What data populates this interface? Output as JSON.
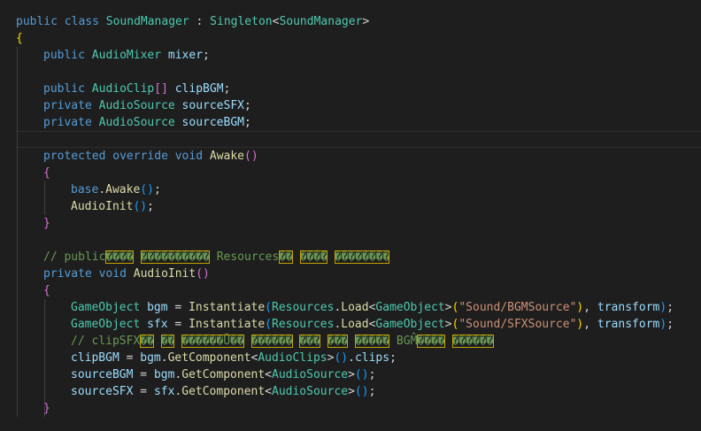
{
  "editor": {
    "lines": [
      {
        "indent": 0,
        "tokens": [
          {
            "t": "public",
            "c": "kw"
          },
          {
            "t": " ",
            "c": "pl"
          },
          {
            "t": "class",
            "c": "kw"
          },
          {
            "t": " ",
            "c": "pl"
          },
          {
            "t": "SoundManager",
            "c": "ty"
          },
          {
            "t": " : ",
            "c": "pl"
          },
          {
            "t": "Singleton",
            "c": "ty"
          },
          {
            "t": "<",
            "c": "pl"
          },
          {
            "t": "SoundManager",
            "c": "ty"
          },
          {
            "t": ">",
            "c": "pl"
          }
        ]
      },
      {
        "indent": 0,
        "tokens": [
          {
            "t": "{",
            "c": "br1"
          }
        ]
      },
      {
        "indent": 1,
        "tokens": [
          {
            "t": "public",
            "c": "kw"
          },
          {
            "t": " ",
            "c": "pl"
          },
          {
            "t": "AudioMixer",
            "c": "ty"
          },
          {
            "t": " ",
            "c": "pl"
          },
          {
            "t": "mixer",
            "c": "var"
          },
          {
            "t": ";",
            "c": "pl"
          }
        ]
      },
      {
        "indent": 0,
        "tokens": []
      },
      {
        "indent": 1,
        "tokens": [
          {
            "t": "public",
            "c": "kw"
          },
          {
            "t": " ",
            "c": "pl"
          },
          {
            "t": "AudioClip",
            "c": "ty"
          },
          {
            "t": "[]",
            "c": "br2"
          },
          {
            "t": " ",
            "c": "pl"
          },
          {
            "t": "clipBGM",
            "c": "var"
          },
          {
            "t": ";",
            "c": "pl"
          }
        ]
      },
      {
        "indent": 1,
        "tokens": [
          {
            "t": "private",
            "c": "kw"
          },
          {
            "t": " ",
            "c": "pl"
          },
          {
            "t": "AudioSource",
            "c": "ty"
          },
          {
            "t": " ",
            "c": "pl"
          },
          {
            "t": "sourceSFX",
            "c": "var"
          },
          {
            "t": ";",
            "c": "pl"
          }
        ]
      },
      {
        "indent": 1,
        "tokens": [
          {
            "t": "private",
            "c": "kw"
          },
          {
            "t": " ",
            "c": "pl"
          },
          {
            "t": "AudioSource",
            "c": "ty"
          },
          {
            "t": " ",
            "c": "pl"
          },
          {
            "t": "sourceBGM",
            "c": "var"
          },
          {
            "t": ";",
            "c": "pl"
          }
        ]
      },
      {
        "indent": 0,
        "tokens": [],
        "current": true
      },
      {
        "indent": 1,
        "tokens": [
          {
            "t": "protected",
            "c": "kw"
          },
          {
            "t": " ",
            "c": "pl"
          },
          {
            "t": "override",
            "c": "kw"
          },
          {
            "t": " ",
            "c": "pl"
          },
          {
            "t": "void",
            "c": "kw"
          },
          {
            "t": " ",
            "c": "pl"
          },
          {
            "t": "Awake",
            "c": "fn"
          },
          {
            "t": "()",
            "c": "br2"
          }
        ]
      },
      {
        "indent": 1,
        "tokens": [
          {
            "t": "{",
            "c": "br2"
          }
        ]
      },
      {
        "indent": 2,
        "tokens": [
          {
            "t": "base",
            "c": "kw"
          },
          {
            "t": ".",
            "c": "pl"
          },
          {
            "t": "Awake",
            "c": "fn"
          },
          {
            "t": "()",
            "c": "br3"
          },
          {
            "t": ";",
            "c": "pl"
          }
        ]
      },
      {
        "indent": 2,
        "tokens": [
          {
            "t": "AudioInit",
            "c": "fn"
          },
          {
            "t": "()",
            "c": "br3"
          },
          {
            "t": ";",
            "c": "pl"
          }
        ]
      },
      {
        "indent": 1,
        "tokens": [
          {
            "t": "}",
            "c": "br2"
          }
        ]
      },
      {
        "indent": 0,
        "tokens": []
      },
      {
        "indent": 1,
        "tokens": [
          {
            "t": "// public",
            "c": "cm"
          },
          {
            "t": "����",
            "c": "bad"
          },
          {
            "t": " ",
            "c": "cm"
          },
          {
            "t": "����������",
            "c": "bad"
          },
          {
            "t": " Resources",
            "c": "cm"
          },
          {
            "t": "��",
            "c": "bad"
          },
          {
            "t": " ",
            "c": "cm"
          },
          {
            "t": "���̂�",
            "c": "bad"
          },
          {
            "t": " ",
            "c": "cm"
          },
          {
            "t": "��������",
            "c": "bad"
          }
        ]
      },
      {
        "indent": 1,
        "tokens": [
          {
            "t": "private",
            "c": "kw"
          },
          {
            "t": " ",
            "c": "pl"
          },
          {
            "t": "void",
            "c": "kw"
          },
          {
            "t": " ",
            "c": "pl"
          },
          {
            "t": "AudioInit",
            "c": "fn"
          },
          {
            "t": "()",
            "c": "br2"
          }
        ]
      },
      {
        "indent": 1,
        "tokens": [
          {
            "t": "{",
            "c": "br2"
          }
        ]
      },
      {
        "indent": 2,
        "tokens": [
          {
            "t": "GameObject",
            "c": "ty"
          },
          {
            "t": " ",
            "c": "pl"
          },
          {
            "t": "bgm",
            "c": "var"
          },
          {
            "t": " = ",
            "c": "pl"
          },
          {
            "t": "Instantiate",
            "c": "fn"
          },
          {
            "t": "(",
            "c": "br3"
          },
          {
            "t": "Resources",
            "c": "ty"
          },
          {
            "t": ".",
            "c": "pl"
          },
          {
            "t": "Load",
            "c": "fn"
          },
          {
            "t": "<",
            "c": "pl"
          },
          {
            "t": "GameObject",
            "c": "ty"
          },
          {
            "t": ">",
            "c": "pl"
          },
          {
            "t": "(",
            "c": "br1"
          },
          {
            "t": "\"Sound/BGMSource\"",
            "c": "str"
          },
          {
            "t": ")",
            "c": "br1"
          },
          {
            "t": ", ",
            "c": "pl"
          },
          {
            "t": "transform",
            "c": "var"
          },
          {
            "t": ")",
            "c": "br3"
          },
          {
            "t": ";",
            "c": "pl"
          }
        ]
      },
      {
        "indent": 2,
        "tokens": [
          {
            "t": "GameObject",
            "c": "ty"
          },
          {
            "t": " ",
            "c": "pl"
          },
          {
            "t": "sfx",
            "c": "var"
          },
          {
            "t": " = ",
            "c": "pl"
          },
          {
            "t": "Instantiate",
            "c": "fn"
          },
          {
            "t": "(",
            "c": "br3"
          },
          {
            "t": "Resources",
            "c": "ty"
          },
          {
            "t": ".",
            "c": "pl"
          },
          {
            "t": "Load",
            "c": "fn"
          },
          {
            "t": "<",
            "c": "pl"
          },
          {
            "t": "GameObject",
            "c": "ty"
          },
          {
            "t": ">",
            "c": "pl"
          },
          {
            "t": "(",
            "c": "br1"
          },
          {
            "t": "\"Sound/SFXSource\"",
            "c": "str"
          },
          {
            "t": ")",
            "c": "br1"
          },
          {
            "t": ", ",
            "c": "pl"
          },
          {
            "t": "transform",
            "c": "var"
          },
          {
            "t": ")",
            "c": "br3"
          },
          {
            "t": ";",
            "c": "pl"
          }
        ]
      },
      {
        "indent": 2,
        "tokens": [
          {
            "t": "// clipSFX",
            "c": "cm"
          },
          {
            "t": "��",
            "c": "bad"
          },
          {
            "t": " ",
            "c": "cm"
          },
          {
            "t": "��",
            "c": "bad"
          },
          {
            "t": " ",
            "c": "cm"
          },
          {
            "t": "������Ŭ��",
            "c": "bad"
          },
          {
            "t": " ",
            "c": "cm"
          },
          {
            "t": "̃������",
            "c": "bad"
          },
          {
            "t": " ",
            "c": "cm"
          },
          {
            "t": "���",
            "c": "bad"
          },
          {
            "t": " ",
            "c": "cm"
          },
          {
            "t": "���",
            "c": "bad"
          },
          {
            "t": " ",
            "c": "cm"
          },
          {
            "t": "�����",
            "c": "bad"
          },
          {
            "t": " BGM",
            "c": "cm"
          },
          {
            "t": "̂����",
            "c": "bad"
          },
          {
            "t": " ",
            "c": "cm"
          },
          {
            "t": "������",
            "c": "bad"
          }
        ]
      },
      {
        "indent": 2,
        "tokens": [
          {
            "t": "clipBGM",
            "c": "var"
          },
          {
            "t": " = ",
            "c": "pl"
          },
          {
            "t": "bgm",
            "c": "var"
          },
          {
            "t": ".",
            "c": "pl"
          },
          {
            "t": "GetComponent",
            "c": "fn"
          },
          {
            "t": "<",
            "c": "pl"
          },
          {
            "t": "AudioClips",
            "c": "ty"
          },
          {
            "t": ">",
            "c": "pl"
          },
          {
            "t": "()",
            "c": "br3"
          },
          {
            "t": ".",
            "c": "pl"
          },
          {
            "t": "clips",
            "c": "var"
          },
          {
            "t": ";",
            "c": "pl"
          }
        ]
      },
      {
        "indent": 2,
        "tokens": [
          {
            "t": "sourceBGM",
            "c": "var"
          },
          {
            "t": " = ",
            "c": "pl"
          },
          {
            "t": "bgm",
            "c": "var"
          },
          {
            "t": ".",
            "c": "pl"
          },
          {
            "t": "GetComponent",
            "c": "fn"
          },
          {
            "t": "<",
            "c": "pl"
          },
          {
            "t": "AudioSource",
            "c": "ty"
          },
          {
            "t": ">",
            "c": "pl"
          },
          {
            "t": "()",
            "c": "br3"
          },
          {
            "t": ";",
            "c": "pl"
          }
        ]
      },
      {
        "indent": 2,
        "tokens": [
          {
            "t": "sourceSFX",
            "c": "var"
          },
          {
            "t": " = ",
            "c": "pl"
          },
          {
            "t": "sfx",
            "c": "var"
          },
          {
            "t": ".",
            "c": "pl"
          },
          {
            "t": "GetComponent",
            "c": "fn"
          },
          {
            "t": "<",
            "c": "pl"
          },
          {
            "t": "AudioSource",
            "c": "ty"
          },
          {
            "t": ">",
            "c": "pl"
          },
          {
            "t": "()",
            "c": "br3"
          },
          {
            "t": ";",
            "c": "pl"
          }
        ]
      },
      {
        "indent": 1,
        "tokens": [
          {
            "t": "}",
            "c": "br2"
          }
        ]
      }
    ]
  }
}
